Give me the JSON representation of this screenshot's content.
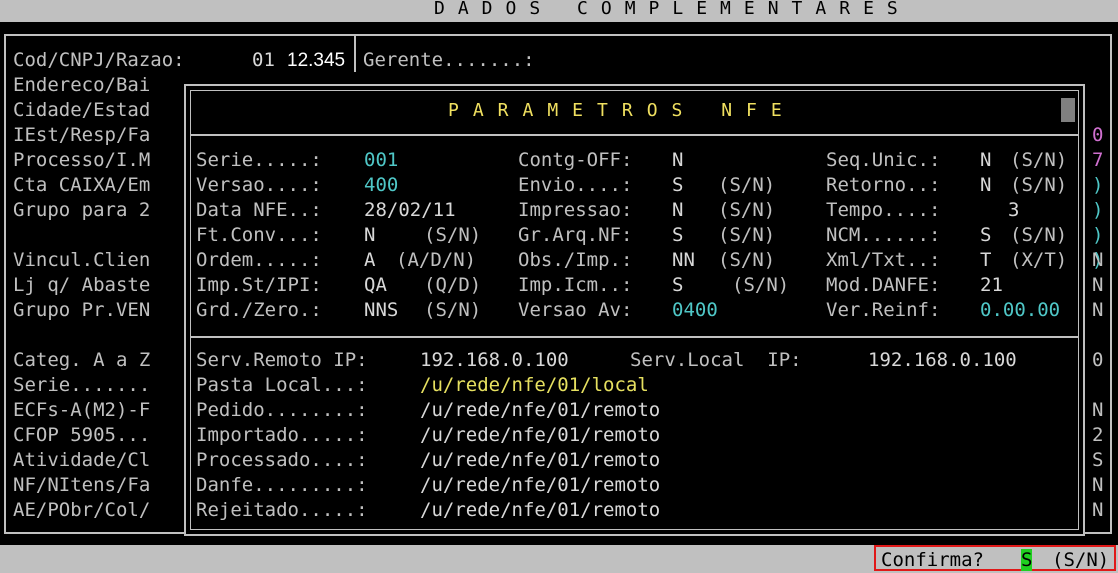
{
  "header": {
    "title": "DADOS COMPLEMENTARES"
  },
  "main": {
    "cod_label": "Cod/CNPJ/Razao:",
    "cod_value": "01",
    "cnpj_value": "12.345",
    "gerente_label": "Gerente.......:",
    "left_labels": [
      "Endereco/Bai",
      "Cidade/Estad",
      "IEst/Resp/Fa",
      "Processo/I.M",
      "Cta CAIXA/Em",
      "Grupo para 2",
      "",
      "Vincul.Clien",
      "Lj q/ Abaste",
      "Grupo Pr.VEN",
      "",
      "Categ. A a Z",
      "Serie.......",
      "ECFs-A(M2)-F",
      "CFOP 5905...",
      "Atividade/Cl",
      "NF/NItens/Fa",
      "AE/PObr/Col/"
    ],
    "right_edge": [
      "0",
      "7",
      ")",
      ")",
      ")",
      ")",
      "N",
      "N",
      "N",
      "",
      "0",
      "",
      "N",
      "2",
      "S",
      "N",
      "N"
    ]
  },
  "popup": {
    "title": "PARAMETROS NFE",
    "col1": [
      {
        "label": "Serie.....:",
        "value": "001",
        "hint": ""
      },
      {
        "label": "Versao....:",
        "value": "400",
        "hint": ""
      },
      {
        "label": "Data NFE..:",
        "value": "28/02/11",
        "hint": ""
      },
      {
        "label": "Ft.Conv...:",
        "value": "N",
        "hint": "(S/N)"
      },
      {
        "label": "Ordem.....:",
        "value": "A",
        "hint": "(A/D/N)"
      },
      {
        "label": "Imp.St/IPI:",
        "value": "QA",
        "hint": "(Q/D)"
      },
      {
        "label": "Grd./Zero.:",
        "value": "NNS",
        "hint": "(S/N)"
      }
    ],
    "col2": [
      {
        "label": "Contg-OFF:",
        "value": "N",
        "hint": ""
      },
      {
        "label": "Envio....:",
        "value": "S",
        "hint": "(S/N)"
      },
      {
        "label": "Impressao:",
        "value": "N",
        "hint": "(S/N)"
      },
      {
        "label": "Gr.Arq.NF:",
        "value": "S",
        "hint": "(S/N)"
      },
      {
        "label": "Obs./Imp.:",
        "value": "NN",
        "hint": "(S/N)"
      },
      {
        "label": "Imp.Icm..:",
        "value": "S",
        "hint": "(S/N)"
      },
      {
        "label": "Versao Av:",
        "value": "0400",
        "hint": ""
      }
    ],
    "col3": [
      {
        "label": "Seq.Unic.:",
        "value": "N",
        "hint": "(S/N)"
      },
      {
        "label": "Retorno..:",
        "value": "N",
        "hint": "(S/N)"
      },
      {
        "label": "Tempo....:",
        "value": "3",
        "hint": ""
      },
      {
        "label": "NCM......:",
        "value": "S",
        "hint": "(S/N)"
      },
      {
        "label": "Xml/Txt..:",
        "value": "T",
        "hint": "(X/T)"
      },
      {
        "label": "Mod.DANFE:",
        "value": "21",
        "hint": ""
      },
      {
        "label": "Ver.Reinf:",
        "value": "0.00.00",
        "hint": ""
      }
    ],
    "serv_remoto_label": "Serv.Remoto IP:",
    "serv_remoto_ip": "192.168.0.100",
    "serv_local_label": "Serv.Local  IP:",
    "serv_local_ip": "192.168.0.100",
    "paths": [
      {
        "label": "Pasta Local...:",
        "value": "/u/rede/nfe/01/local"
      },
      {
        "label": "Pedido........:",
        "value": "/u/rede/nfe/01/remoto"
      },
      {
        "label": "Importado.....:",
        "value": "/u/rede/nfe/01/remoto"
      },
      {
        "label": "Processado....:",
        "value": "/u/rede/nfe/01/remoto"
      },
      {
        "label": "Danfe.........:",
        "value": "/u/rede/nfe/01/remoto"
      },
      {
        "label": "Rejeitado.....:",
        "value": "/u/rede/nfe/01/remoto"
      }
    ]
  },
  "footer": {
    "confirm_label": "Confirma?",
    "confirm_value": "S",
    "confirm_hint": "(S/N)"
  },
  "colors": {
    "accent_yellow": "#e6e060",
    "cyan": "#4fc7c7",
    "selection_green": "#20d020",
    "frame_red": "#e01818"
  }
}
